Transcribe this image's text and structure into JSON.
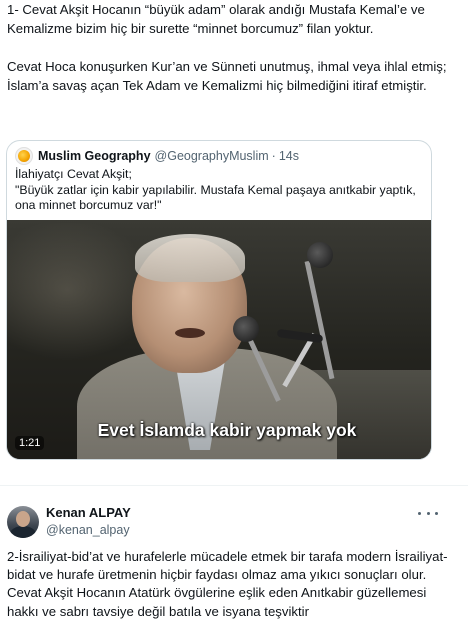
{
  "tweet1": {
    "paragraphs": [
      "1- Cevat Akşit Hocanın “büyük adam” olarak andığı Mustafa Kemal’e ve Kemalizme bizim hiç bir surette “minnet borcumuz” filan yoktur.",
      "Cevat Hoca konuşurken Kur’an ve Sünneti unutmuş, ihmal veya ihlal etmiş; İslam’a savaş açan Tek Adam ve Kemalizmi hiç bilmediğini itiraf etmiştir."
    ]
  },
  "quote": {
    "avatar_icon": "globe-logo-icon",
    "name": "Muslim Geography",
    "handle": "@GeographyMuslim",
    "dot": "·",
    "time": "14s",
    "lines": [
      "İlahiyatçı Cevat Akşit;",
      "\"Büyük zatlar için kabir yapılabilir. Mustafa Kemal paşaya anıtkabir yaptık, ona minnet borcumuz var!\""
    ],
    "video": {
      "duration": "1:21",
      "subtitle": "Evet İslamda kabir yapmak yok"
    }
  },
  "tweet2": {
    "name": "Kenan ALPAY",
    "handle": "@kenan_alpay",
    "more_icon": "more-horizontal-icon",
    "lines": [
      "2-İsrailiyat-bid’at ve hurafelerle mücadele etmek bir tarafa modern İsrailiyat-bidat ve hurafe üretmenin hiçbir faydası olmaz ama yıkıcı sonuçları olur.",
      "Cevat Akşit Hocanın Atatürk övgülerine eşlik eden Anıtkabir güzellemesi hakkı ve sabrı tavsiye değil batıla ve isyana teşviktir"
    ]
  }
}
